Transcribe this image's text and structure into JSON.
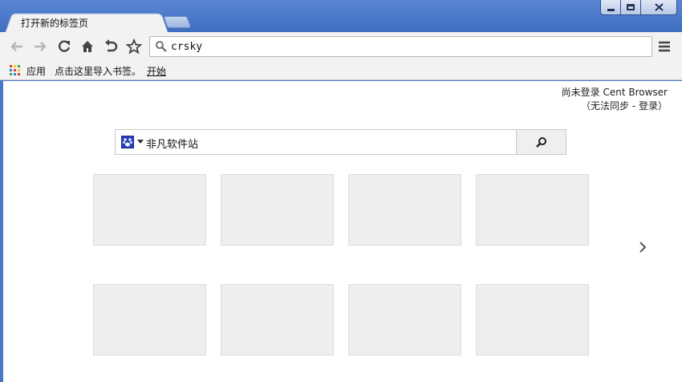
{
  "window": {
    "tab_title": "打开新的标签页"
  },
  "toolbar": {
    "back_icon": "back-arrow-icon",
    "forward_icon": "forward-arrow-icon",
    "reload_icon": "reload-icon",
    "home_icon": "home-icon",
    "undo_icon": "undo-close-tab-icon",
    "star_icon": "star-icon",
    "omnibox_value": "crsky",
    "menu_icon": "hamburger-menu-icon"
  },
  "bookmarks": {
    "apps_label": "应用",
    "import_label": "点击这里导入书签。",
    "start_link": "开始"
  },
  "page": {
    "signin_line1": "尚未登录 Cent Browser",
    "signin_line2_prefix": "（无法同步 - ",
    "signin_line2_link": "登录",
    "signin_line2_suffix": "）",
    "search_engine_text": "非凡软件站",
    "search_button_icon": "search-icon",
    "next_page_icon": "chevron-right-icon"
  },
  "colors": {
    "frame_blue": "#4a77c6",
    "toolbar_bg": "#f2f2f2",
    "tile_bg": "#eeeeee"
  }
}
